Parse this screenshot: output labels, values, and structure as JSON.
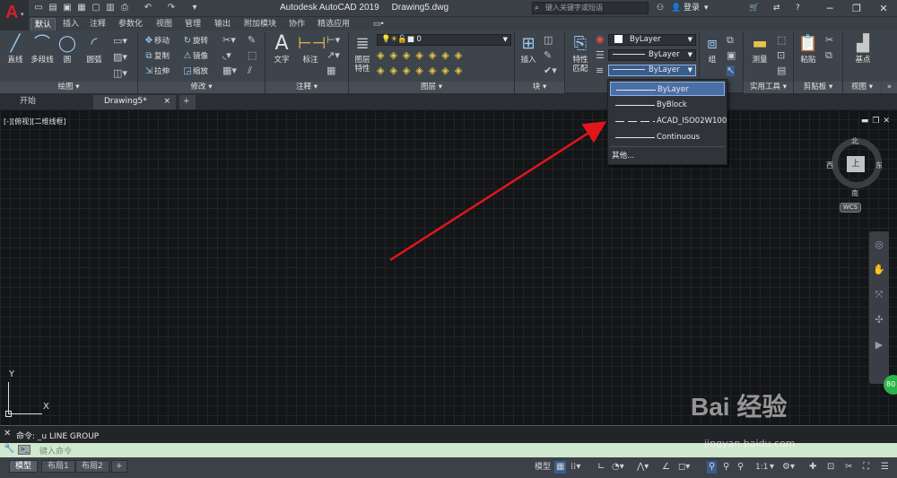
{
  "title": {
    "app": "Autodesk AutoCAD 2019",
    "doc": "Drawing5.dwg"
  },
  "search": {
    "placeholder": "键入关键字或短语"
  },
  "account": {
    "login": "登录"
  },
  "tabs": [
    "默认",
    "插入",
    "注释",
    "参数化",
    "视图",
    "管理",
    "输出",
    "附加模块",
    "协作",
    "精选应用"
  ],
  "draw_panel": {
    "label": "绘图",
    "line": "直线",
    "polyline": "多段线",
    "circle": "圆",
    "arc": "圆弧"
  },
  "modify_panel": {
    "label": "修改",
    "move": "移动",
    "rotate": "旋转",
    "copy": "复制",
    "mirror": "镜像",
    "stretch": "拉伸",
    "scale": "缩放"
  },
  "annotation_panel": {
    "label": "注释",
    "text": "文字",
    "dimension": "标注"
  },
  "layers_panel": {
    "label": "图层",
    "props": "图层\n特性",
    "current_layer": "0"
  },
  "block_panel": {
    "label": "块",
    "insert": "插入"
  },
  "properties_panel": {
    "match_top": "特性",
    "match_bottom": "匹配",
    "color": "ByLayer",
    "linetype": "ByLayer",
    "lineweight": "ByLayer"
  },
  "groups_panel": {
    "group": "组"
  },
  "utilities_panel": {
    "label": "实用工具",
    "measure": "测量"
  },
  "clipboard_panel": {
    "label": "剪贴板",
    "paste": "粘贴"
  },
  "view_panel": {
    "label": "视图",
    "base": "基点"
  },
  "doc_tabs": {
    "start": "开始",
    "active": "Drawing5*"
  },
  "viewport": {
    "label": "[-][俯视][二维线框]"
  },
  "compass": {
    "n": "北",
    "s": "南",
    "e": "东",
    "w": "西",
    "cube": "上",
    "wcs": "WCS"
  },
  "ucs": {
    "x": "X",
    "y": "Y"
  },
  "linetype_menu": {
    "options": [
      "ByLayer",
      "ByBlock",
      "ACAD_ISO02W100",
      "Continuous"
    ],
    "selected": "ByLayer",
    "other": "其他..."
  },
  "command": {
    "history": "命令: _u LINE GROUP",
    "placeholder": "键入命令"
  },
  "layout_tabs": [
    "模型",
    "布局1",
    "布局2"
  ],
  "status": {
    "model": "模型",
    "scale": "1:1"
  },
  "badge": {
    "value": "80"
  },
  "watermark": {
    "text": "Bai 经验",
    "url": "jingyan.baidu.com"
  },
  "colors": {
    "arrow": "#e0161b",
    "accent": "#4a6fa6",
    "brand_red": "#d1202d"
  }
}
